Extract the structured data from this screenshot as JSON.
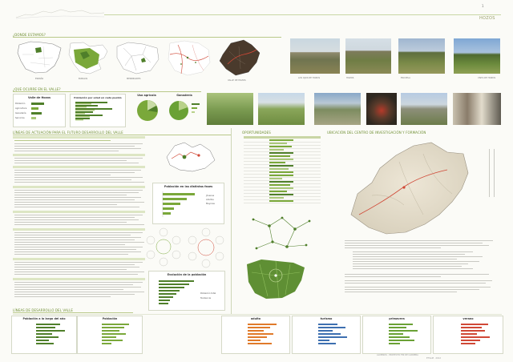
{
  "header": {
    "page_number": "1",
    "title": "HOZOS"
  },
  "sections": {
    "donde": "¿DONDE ESTAMOS?",
    "que_ocurre": "¿QUE OCURRE EN EL VALLE?",
    "plan": "LÍNEAS DE ACTUACIÓN PARA EL FUTURO DESARROLLO DEL VALLE",
    "oportunidades": "OPORTUNIDADES",
    "ubicacion": "UBICACIÓN DEL CENTRO DE INVESTIGACIÓN Y FORMACIÓN",
    "lineas": "LÍNEAS DE DESARROLLO DEL VALLE"
  },
  "location_maps": [
    "ESPAÑA",
    "BURGOS",
    "MERINDADES",
    "",
    "VALLE DE HOZOS"
  ],
  "landscape_photos": [
    "",
    "LOS OJOS DE HOZOS",
    "HOZOS",
    "ESCUELA",
    "",
    "VISTA DE HOZOS"
  ],
  "small_charts": {
    "valle": {
      "title": "Valle de Hozos",
      "labels": [
        "Población",
        "Agricultura",
        "Ganadería",
        "Servicios"
      ]
    },
    "edad": {
      "title": "Población por edad en cada pueblo"
    },
    "agricola": {
      "title": "Uso agrícola"
    },
    "ganaderia": {
      "title": "Ganadería"
    }
  },
  "center_charts": {
    "fases": {
      "title": "Población en las distintas fases",
      "legend": [
        "Jóvenes",
        "Adultos",
        "Mayores"
      ]
    },
    "evolucion": {
      "title": "Evolución de la población",
      "legend": [
        "Población total",
        "Tendencia"
      ]
    }
  },
  "bottom_charts": [
    {
      "title": "Población a lo largo del año",
      "color": "#4f7f2a"
    },
    {
      "title": "Población",
      "color": "#7aa83a"
    },
    {
      "title": "adulto",
      "color": "#e07a2a"
    },
    {
      "title": "turismo",
      "color": "#3d6fb0"
    },
    {
      "title": "primavera",
      "color": "#6aa135"
    },
    {
      "title": "verano",
      "color": "#d04836"
    }
  ],
  "ubicacion_note": "",
  "footer": {
    "credits": "ALUMNOS · PROYECTO FIN DE CARRERA",
    "date": "ETSAM · 2012"
  },
  "colors": {
    "accent": "#6f8f33",
    "map_green": "#7aa83a",
    "map_dark": "#4f7f2a"
  }
}
